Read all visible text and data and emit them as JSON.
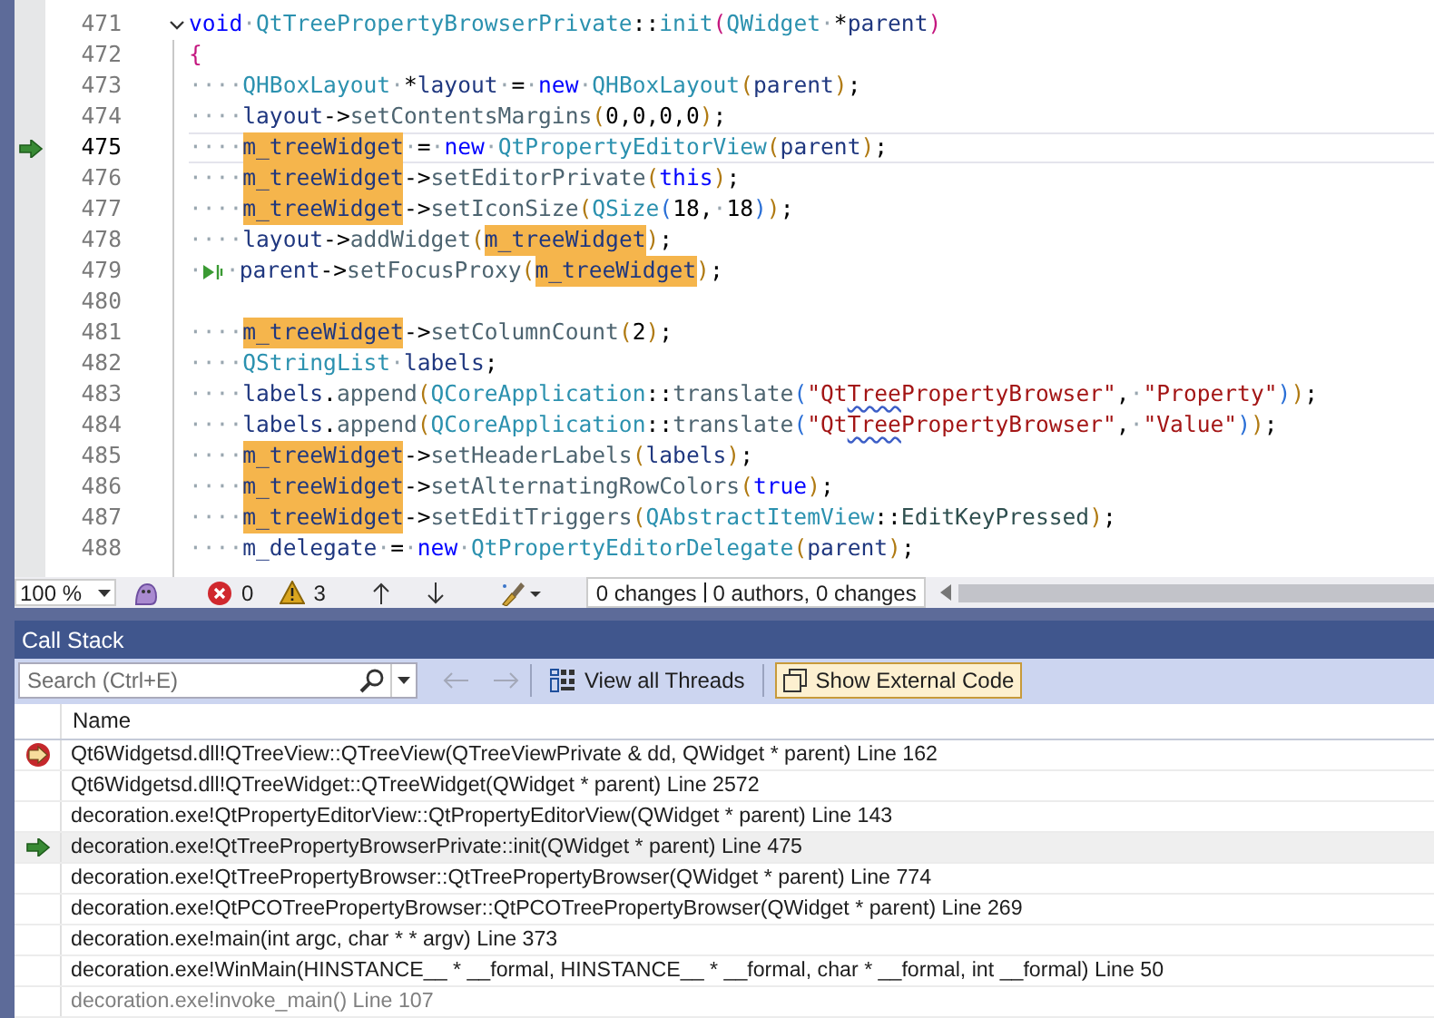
{
  "editor": {
    "lines": [
      {
        "number": "471",
        "current": false,
        "caller": false,
        "fold": true,
        "tokens": [
          {
            "kind": "kw",
            "text": "void"
          },
          {
            "kind": "ws",
            "text": "·"
          },
          {
            "kind": "type",
            "text": "QtTreePropertyBrowserPrivate"
          },
          {
            "kind": "op",
            "text": "::"
          },
          {
            "kind": "type",
            "text": "init"
          },
          {
            "kind": "pa",
            "text": "("
          },
          {
            "kind": "type",
            "text": "QWidget"
          },
          {
            "kind": "ws",
            "text": "·"
          },
          {
            "kind": "op",
            "text": "*"
          },
          {
            "kind": "var",
            "text": "parent"
          },
          {
            "kind": "pa",
            "text": ")"
          }
        ]
      },
      {
        "number": "472",
        "current": false,
        "caller": false,
        "fold": false,
        "tokens": [
          {
            "kind": "pa",
            "text": "{"
          }
        ]
      },
      {
        "number": "473",
        "current": false,
        "caller": false,
        "fold": false,
        "tokens": [
          {
            "kind": "ws",
            "text": "····"
          },
          {
            "kind": "type",
            "text": "QHBoxLayout"
          },
          {
            "kind": "ws",
            "text": "·"
          },
          {
            "kind": "op",
            "text": "*"
          },
          {
            "kind": "var",
            "text": "layout"
          },
          {
            "kind": "ws",
            "text": "·"
          },
          {
            "kind": "op",
            "text": "="
          },
          {
            "kind": "ws",
            "text": "·"
          },
          {
            "kind": "kw",
            "text": "new"
          },
          {
            "kind": "ws",
            "text": "·"
          },
          {
            "kind": "type",
            "text": "QHBoxLayout"
          },
          {
            "kind": "pb",
            "text": "("
          },
          {
            "kind": "var",
            "text": "parent"
          },
          {
            "kind": "pb",
            "text": ")"
          },
          {
            "kind": "op",
            "text": ";"
          }
        ]
      },
      {
        "number": "474",
        "current": false,
        "caller": false,
        "fold": false,
        "tokens": [
          {
            "kind": "ws",
            "text": "····"
          },
          {
            "kind": "var",
            "text": "layout"
          },
          {
            "kind": "op",
            "text": "->"
          },
          {
            "kind": "fn",
            "text": "setContentsMargins"
          },
          {
            "kind": "pb",
            "text": "("
          },
          {
            "kind": "num",
            "text": "0,0,0,0"
          },
          {
            "kind": "pb",
            "text": ")"
          },
          {
            "kind": "op",
            "text": ";"
          }
        ]
      },
      {
        "number": "475",
        "current": true,
        "fold": false,
        "caller": true,
        "tokens": [
          {
            "kind": "ws",
            "text": "····"
          },
          {
            "kind": "hl",
            "text": "m_treeWidget"
          },
          {
            "kind": "ws",
            "text": "·"
          },
          {
            "kind": "op",
            "text": "="
          },
          {
            "kind": "ws",
            "text": "·"
          },
          {
            "kind": "kw",
            "text": "new"
          },
          {
            "kind": "ws",
            "text": "·"
          },
          {
            "kind": "type",
            "text": "QtPropertyEditorView"
          },
          {
            "kind": "pb",
            "text": "("
          },
          {
            "kind": "var",
            "text": "parent"
          },
          {
            "kind": "pb",
            "text": ")"
          },
          {
            "kind": "op",
            "text": ";"
          }
        ]
      },
      {
        "number": "476",
        "current": false,
        "caller": false,
        "fold": false,
        "tokens": [
          {
            "kind": "ws",
            "text": "····"
          },
          {
            "kind": "hl",
            "text": "m_treeWidget"
          },
          {
            "kind": "op",
            "text": "->"
          },
          {
            "kind": "fn",
            "text": "setEditorPrivate"
          },
          {
            "kind": "pb",
            "text": "("
          },
          {
            "kind": "kw",
            "text": "this"
          },
          {
            "kind": "pb",
            "text": ")"
          },
          {
            "kind": "op",
            "text": ";"
          }
        ]
      },
      {
        "number": "477",
        "current": false,
        "caller": false,
        "fold": false,
        "tokens": [
          {
            "kind": "ws",
            "text": "····"
          },
          {
            "kind": "hl",
            "text": "m_treeWidget"
          },
          {
            "kind": "op",
            "text": "->"
          },
          {
            "kind": "fn",
            "text": "setIconSize"
          },
          {
            "kind": "pb",
            "text": "("
          },
          {
            "kind": "type",
            "text": "QSize"
          },
          {
            "kind": "pc",
            "text": "("
          },
          {
            "kind": "num",
            "text": "18"
          },
          {
            "kind": "op",
            "text": ","
          },
          {
            "kind": "ws",
            "text": "·"
          },
          {
            "kind": "num",
            "text": "18"
          },
          {
            "kind": "pc",
            "text": ")"
          },
          {
            "kind": "pb",
            "text": ")"
          },
          {
            "kind": "op",
            "text": ";"
          }
        ]
      },
      {
        "number": "478",
        "current": false,
        "caller": false,
        "fold": false,
        "tokens": [
          {
            "kind": "ws",
            "text": "····"
          },
          {
            "kind": "var",
            "text": "layout"
          },
          {
            "kind": "op",
            "text": "->"
          },
          {
            "kind": "fn",
            "text": "addWidget"
          },
          {
            "kind": "pb",
            "text": "("
          },
          {
            "kind": "hl",
            "text": "m_treeWidget"
          },
          {
            "kind": "pb",
            "text": ")"
          },
          {
            "kind": "op",
            "text": ";"
          }
        ]
      },
      {
        "number": "479",
        "current": false,
        "caller": false,
        "fold": false,
        "tokens": [
          {
            "kind": "ws",
            "text": "·"
          },
          {
            "kind": "glyph"
          },
          {
            "kind": "ws",
            "text": "·"
          },
          {
            "kind": "var",
            "text": "parent"
          },
          {
            "kind": "op",
            "text": "->"
          },
          {
            "kind": "fn",
            "text": "setFocusProxy"
          },
          {
            "kind": "pb",
            "text": "("
          },
          {
            "kind": "hl",
            "text": "m_treeWidget"
          },
          {
            "kind": "pb",
            "text": ")"
          },
          {
            "kind": "op",
            "text": ";"
          }
        ]
      },
      {
        "number": "480",
        "current": false,
        "caller": false,
        "fold": false
      },
      {
        "number": "481",
        "current": false,
        "caller": false,
        "fold": false,
        "tokens": [
          {
            "kind": "ws",
            "text": "····"
          },
          {
            "kind": "hl",
            "text": "m_treeWidget"
          },
          {
            "kind": "op",
            "text": "->"
          },
          {
            "kind": "fn",
            "text": "setColumnCount"
          },
          {
            "kind": "pb",
            "text": "("
          },
          {
            "kind": "num",
            "text": "2"
          },
          {
            "kind": "pb",
            "text": ")"
          },
          {
            "kind": "op",
            "text": ";"
          }
        ]
      },
      {
        "number": "482",
        "current": false,
        "caller": false,
        "fold": false,
        "tokens": [
          {
            "kind": "ws",
            "text": "····"
          },
          {
            "kind": "type",
            "text": "QStringList"
          },
          {
            "kind": "ws",
            "text": "·"
          },
          {
            "kind": "var",
            "text": "labels"
          },
          {
            "kind": "op",
            "text": ";"
          }
        ]
      },
      {
        "number": "483",
        "current": false,
        "caller": false,
        "fold": false,
        "tokens": [
          {
            "kind": "ws",
            "text": "····"
          },
          {
            "kind": "var",
            "text": "labels"
          },
          {
            "kind": "op",
            "text": "."
          },
          {
            "kind": "fn",
            "text": "append"
          },
          {
            "kind": "pb",
            "text": "("
          },
          {
            "kind": "type",
            "text": "QCoreApplication"
          },
          {
            "kind": "op",
            "text": "::"
          },
          {
            "kind": "fn",
            "text": "translate"
          },
          {
            "kind": "pc",
            "text": "("
          },
          {
            "kind": "str",
            "text": "\"Qt"
          },
          {
            "kind": "sq",
            "text": "Tree"
          },
          {
            "kind": "str",
            "text": "PropertyBrowser\""
          },
          {
            "kind": "op",
            "text": ","
          },
          {
            "kind": "ws",
            "text": "·"
          },
          {
            "kind": "str",
            "text": "\"Property\""
          },
          {
            "kind": "pc",
            "text": ")"
          },
          {
            "kind": "pb",
            "text": ")"
          },
          {
            "kind": "op",
            "text": ";"
          }
        ]
      },
      {
        "number": "484",
        "current": false,
        "caller": false,
        "fold": false,
        "tokens": [
          {
            "kind": "ws",
            "text": "····"
          },
          {
            "kind": "var",
            "text": "labels"
          },
          {
            "kind": "op",
            "text": "."
          },
          {
            "kind": "fn",
            "text": "append"
          },
          {
            "kind": "pb",
            "text": "("
          },
          {
            "kind": "type",
            "text": "QCoreApplication"
          },
          {
            "kind": "op",
            "text": "::"
          },
          {
            "kind": "fn",
            "text": "translate"
          },
          {
            "kind": "pc",
            "text": "("
          },
          {
            "kind": "str",
            "text": "\"Qt"
          },
          {
            "kind": "sq",
            "text": "Tree"
          },
          {
            "kind": "str",
            "text": "PropertyBrowser\""
          },
          {
            "kind": "op",
            "text": ","
          },
          {
            "kind": "ws",
            "text": "·"
          },
          {
            "kind": "str",
            "text": "\"Value\""
          },
          {
            "kind": "pc",
            "text": ")"
          },
          {
            "kind": "pb",
            "text": ")"
          },
          {
            "kind": "op",
            "text": ";"
          }
        ]
      },
      {
        "number": "485",
        "current": false,
        "caller": false,
        "fold": false,
        "tokens": [
          {
            "kind": "ws",
            "text": "····"
          },
          {
            "kind": "hl",
            "text": "m_treeWidget"
          },
          {
            "kind": "op",
            "text": "->"
          },
          {
            "kind": "fn",
            "text": "setHeaderLabels"
          },
          {
            "kind": "pb",
            "text": "("
          },
          {
            "kind": "var",
            "text": "labels"
          },
          {
            "kind": "pb",
            "text": ")"
          },
          {
            "kind": "op",
            "text": ";"
          }
        ]
      },
      {
        "number": "486",
        "current": false,
        "caller": false,
        "fold": false,
        "tokens": [
          {
            "kind": "ws",
            "text": "····"
          },
          {
            "kind": "hl",
            "text": "m_treeWidget"
          },
          {
            "kind": "op",
            "text": "->"
          },
          {
            "kind": "fn",
            "text": "setAlternatingRowColors"
          },
          {
            "kind": "pb",
            "text": "("
          },
          {
            "kind": "kw",
            "text": "true"
          },
          {
            "kind": "pb",
            "text": ")"
          },
          {
            "kind": "op",
            "text": ";"
          }
        ]
      },
      {
        "number": "487",
        "current": false,
        "caller": false,
        "fold": false,
        "tokens": [
          {
            "kind": "ws",
            "text": "····"
          },
          {
            "kind": "hl",
            "text": "m_treeWidget"
          },
          {
            "kind": "op",
            "text": "->"
          },
          {
            "kind": "fn",
            "text": "setEditTriggers"
          },
          {
            "kind": "pb",
            "text": "("
          },
          {
            "kind": "type",
            "text": "QAbstractItemView"
          },
          {
            "kind": "op",
            "text": "::"
          },
          {
            "kind": "enum",
            "text": "EditKeyPressed"
          },
          {
            "kind": "pb",
            "text": ")"
          },
          {
            "kind": "op",
            "text": ";"
          }
        ]
      },
      {
        "number": "488",
        "current": false,
        "caller": false,
        "fold": false,
        "tokens": [
          {
            "kind": "ws",
            "text": "····"
          },
          {
            "kind": "var",
            "text": "m_delegate"
          },
          {
            "kind": "ws",
            "text": "·"
          },
          {
            "kind": "op",
            "text": "="
          },
          {
            "kind": "ws",
            "text": "·"
          },
          {
            "kind": "kw",
            "text": "new"
          },
          {
            "kind": "ws",
            "text": "·"
          },
          {
            "kind": "type",
            "text": "QtPropertyEditorDelegate"
          },
          {
            "kind": "pb",
            "text": "("
          },
          {
            "kind": "var",
            "text": "parent"
          },
          {
            "kind": "pb",
            "text": ")"
          },
          {
            "kind": "op",
            "text": ";"
          }
        ]
      }
    ]
  },
  "status_bar": {
    "zoom": "100 %",
    "errors": "0",
    "warnings": "3",
    "changes": "0 changes",
    "authors": "0 authors, 0 changes"
  },
  "call_stack": {
    "title": "Call Stack",
    "search": {
      "placeholder": "Search (Ctrl+E)"
    },
    "view_all_threads": "View all Threads",
    "show_external_code": {
      "label": "Show External Code",
      "checked": true
    },
    "columns": [
      "Name"
    ],
    "rows": [
      {
        "text": "Qt6Widgetsd.dll!QTreeView::QTreeView(QTreeViewPrivate & dd, QWidget * parent) Line 162",
        "kind": "current",
        "selected": false,
        "disabled": false
      },
      {
        "text": "Qt6Widgetsd.dll!QTreeWidget::QTreeWidget(QWidget * parent) Line 2572",
        "kind": "plain",
        "selected": false,
        "disabled": false
      },
      {
        "text": "decoration.exe!QtPropertyEditorView::QtPropertyEditorView(QWidget * parent) Line 143",
        "kind": "plain",
        "selected": false,
        "disabled": false
      },
      {
        "text": "decoration.exe!QtTreePropertyBrowserPrivate::init(QWidget * parent) Line 475",
        "kind": "caller",
        "selected": true,
        "disabled": false
      },
      {
        "text": "decoration.exe!QtTreePropertyBrowser::QtTreePropertyBrowser(QWidget * parent) Line 774",
        "kind": "plain",
        "selected": false,
        "disabled": false
      },
      {
        "text": "decoration.exe!QtPCOTreePropertyBrowser::QtPCOTreePropertyBrowser(QWidget * parent) Line 269",
        "kind": "plain",
        "selected": false,
        "disabled": false
      },
      {
        "text": "decoration.exe!main(int argc, char * * argv) Line 373",
        "kind": "plain",
        "selected": false,
        "disabled": false
      },
      {
        "text": "decoration.exe!WinMain(HINSTANCE__ * __formal, HINSTANCE__ * __formal, char * __formal, int __formal) Line 50",
        "kind": "plain",
        "selected": false,
        "disabled": false
      },
      {
        "text": "decoration.exe!invoke_main() Line 107",
        "kind": "plain",
        "selected": false,
        "disabled": true
      }
    ]
  }
}
